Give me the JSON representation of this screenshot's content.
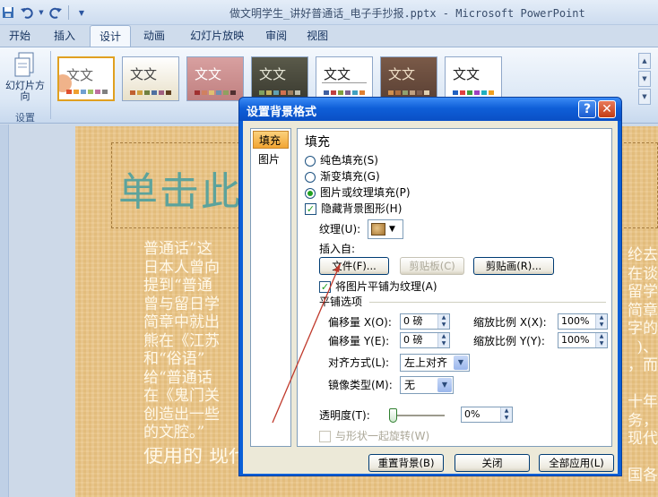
{
  "window": {
    "title": "做文明学生_讲好普通话_电子手抄报.pptx - Microsoft PowerPoint"
  },
  "ribbon": {
    "tabs": [
      {
        "label": "开始"
      },
      {
        "label": "插入"
      },
      {
        "label": "设计",
        "active": true
      },
      {
        "label": "动画"
      },
      {
        "label": "幻灯片放映"
      },
      {
        "label": "审阅"
      },
      {
        "label": "视图"
      }
    ],
    "orientation_label": "幻灯片方向",
    "group_label": "设置",
    "theme_text": "文文",
    "theme_count": 7
  },
  "slide": {
    "title": "单击此",
    "body_lines": [
      "普通话”这",
      "日本人曾向",
      "提到“普通",
      "曾与留日学",
      "简章中就出",
      "熊在《江苏",
      "和“俗语”",
      "给“普通话",
      "在《鬼门关",
      "创造出一些",
      "的文腔。”"
    ],
    "right_fragments": [
      "纶去",
      "在谈",
      "留学",
      "简章",
      "字的",
      ")、",
      "，而",
      "十年",
      "务，",
      "现代",
      "国各"
    ],
    "last_line": "使用的 现代‘人话’的 多元节的 有结"
  },
  "dialog": {
    "title": "设置背景格式",
    "help": "?",
    "close": "✕",
    "nav": [
      {
        "label": "填充",
        "selected": true
      },
      {
        "label": "图片",
        "selected": false
      }
    ],
    "section_title": "填充",
    "fill_options": [
      {
        "label": "纯色填充(S)",
        "checked": false
      },
      {
        "label": "渐变填充(G)",
        "checked": false
      },
      {
        "label": "图片或纹理填充(P)",
        "checked": true
      }
    ],
    "hide_bg_graphics": {
      "label": "隐藏背景图形(H)",
      "checked": true
    },
    "texture_label": "纹理(U):",
    "insert_from_label": "插入自:",
    "file_button": "文件(F)...",
    "clipboard_button": "剪贴板(C)",
    "clipart_button": "剪贴画(R)...",
    "tile_checkbox": {
      "label": "将图片平铺为纹理(A)",
      "checked": true
    },
    "tile_options_label": "平铺选项",
    "offset_x_label": "偏移量 X(O):",
    "offset_x_value": "0 磅",
    "offset_y_label": "偏移量 Y(E):",
    "offset_y_value": "0 磅",
    "scale_x_label": "缩放比例 X(X):",
    "scale_x_value": "100%",
    "scale_y_label": "缩放比例 Y(Y):",
    "scale_y_value": "100%",
    "align_label": "对齐方式(L):",
    "align_value": "左上对齐",
    "mirror_label": "镜像类型(M):",
    "mirror_value": "无",
    "transparency_label": "透明度(T):",
    "transparency_value": "0%",
    "transparency_level": 0,
    "rotate_with_shape": {
      "label": "与形状一起旋转(W)",
      "checked": false,
      "disabled": true
    },
    "reset_button": "重置背景(B)",
    "close_button": "关闭",
    "apply_all_button": "全部应用(L)"
  },
  "colors": {
    "accent_red": "#c0392b",
    "dialog_blue": "#0a5fd7",
    "slide_bg": "#e9c486",
    "title_teal": "#5ca39c"
  }
}
